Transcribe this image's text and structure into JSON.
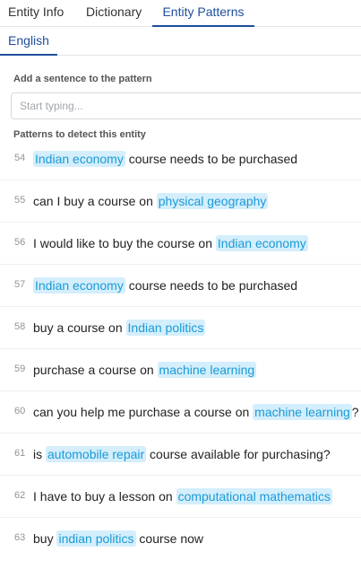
{
  "tabs": [
    {
      "label": "Entity Info"
    },
    {
      "label": "Dictionary"
    },
    {
      "label": "Entity Patterns"
    }
  ],
  "languages": [
    {
      "label": "English"
    }
  ],
  "add_sentence": {
    "label": "Add a sentence to the pattern",
    "placeholder": "Start typing..."
  },
  "patterns_label": "Patterns to detect this entity",
  "colors": {
    "accent": "#1e4f9c",
    "entity_bg": "#d4eefc",
    "entity_text": "#1a9bd6"
  },
  "patterns": [
    {
      "num": "54",
      "segments": [
        {
          "text": "Indian economy",
          "entity": true
        },
        {
          "text": " course needs to be purchased",
          "entity": false
        }
      ]
    },
    {
      "num": "55",
      "segments": [
        {
          "text": "can I buy a course on ",
          "entity": false
        },
        {
          "text": "physical geography",
          "entity": true
        }
      ]
    },
    {
      "num": "56",
      "segments": [
        {
          "text": "I would like to buy the course on ",
          "entity": false
        },
        {
          "text": "Indian economy",
          "entity": true
        }
      ]
    },
    {
      "num": "57",
      "segments": [
        {
          "text": "Indian economy",
          "entity": true
        },
        {
          "text": " course needs to be purchased",
          "entity": false
        }
      ]
    },
    {
      "num": "58",
      "segments": [
        {
          "text": "buy a course on ",
          "entity": false
        },
        {
          "text": "Indian politics",
          "entity": true
        }
      ]
    },
    {
      "num": "59",
      "segments": [
        {
          "text": "purchase a course on ",
          "entity": false
        },
        {
          "text": "machine learning",
          "entity": true
        }
      ]
    },
    {
      "num": "60",
      "segments": [
        {
          "text": "can you help me purchase a course on ",
          "entity": false
        },
        {
          "text": "machine learning",
          "entity": true
        },
        {
          "text": "?",
          "entity": false
        }
      ]
    },
    {
      "num": "61",
      "segments": [
        {
          "text": "is ",
          "entity": false
        },
        {
          "text": "automobile repair",
          "entity": true
        },
        {
          "text": " course available for purchasing?",
          "entity": false
        }
      ]
    },
    {
      "num": "62",
      "segments": [
        {
          "text": "I have to buy a lesson on ",
          "entity": false
        },
        {
          "text": "computational mathematics",
          "entity": true
        }
      ]
    },
    {
      "num": "63",
      "segments": [
        {
          "text": "buy ",
          "entity": false
        },
        {
          "text": "indian politics",
          "entity": true
        },
        {
          "text": " course now",
          "entity": false
        }
      ]
    }
  ]
}
